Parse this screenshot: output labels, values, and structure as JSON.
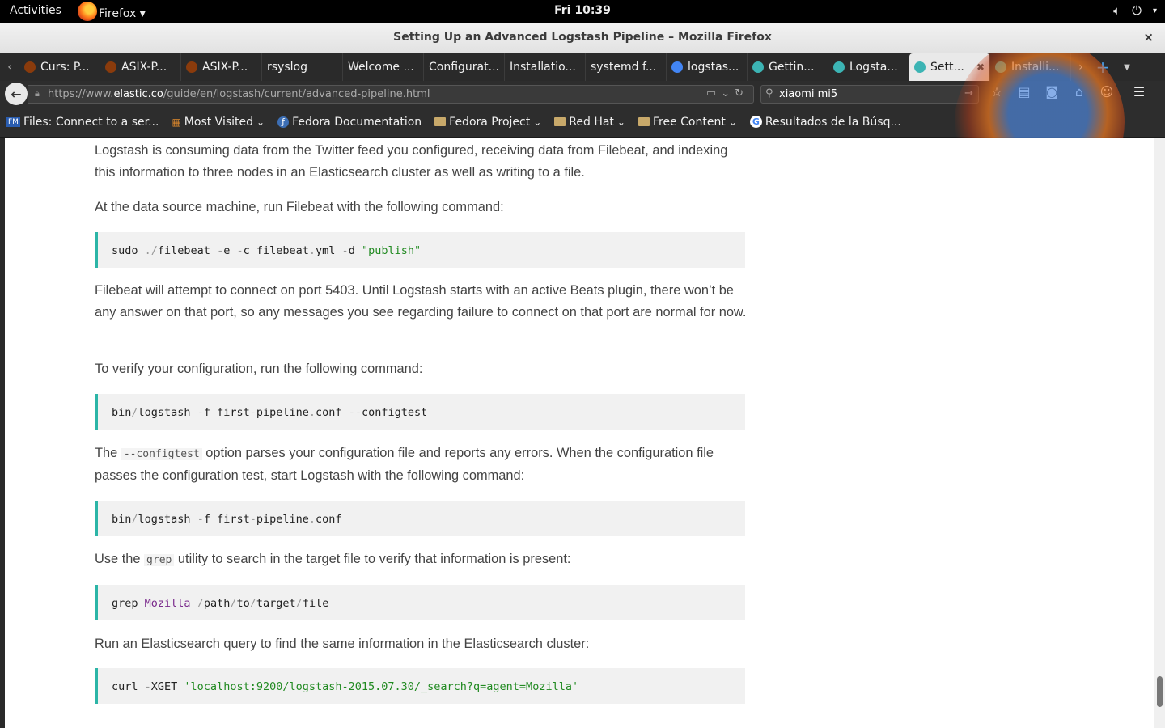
{
  "topbar": {
    "activities": "Activities",
    "app_name": "Firefox ▾",
    "clock": "Fri 10:39"
  },
  "window": {
    "title": "Setting Up an Advanced Logstash Pipeline – Mozilla Firefox",
    "close": "×"
  },
  "tabs": [
    {
      "label": "Curs: P...",
      "favicon_color": "#8a3b0c"
    },
    {
      "label": "ASIX-P...",
      "favicon_color": "#8a3b0c"
    },
    {
      "label": "ASIX-P...",
      "favicon_color": "#8a3b0c"
    },
    {
      "label": "rsyslog",
      "favicon_color": ""
    },
    {
      "label": "Welcome ...",
      "favicon_color": ""
    },
    {
      "label": "Configurat...",
      "favicon_color": ""
    },
    {
      "label": "Installatio...",
      "favicon_color": ""
    },
    {
      "label": "systemd f...",
      "favicon_color": ""
    },
    {
      "label": "logstas...",
      "favicon_color": "#4285f4"
    },
    {
      "label": "Gettin...",
      "favicon_color": "#3cb4b4"
    },
    {
      "label": "Logsta...",
      "favicon_color": "#3cb4b4"
    },
    {
      "label": "Sett...",
      "favicon_color": "#3cb4b4",
      "active": true
    },
    {
      "label": "Installi...",
      "favicon_color": "#3cb4b4"
    }
  ],
  "navbar": {
    "url_prefix": "https://www.",
    "url_domain": "elastic.co",
    "url_path": "/guide/en/logstash/current/advanced-pipeline.html",
    "search_value": "xiaomi mi5"
  },
  "bookmarks": [
    {
      "label": "Files: Connect to a ser...",
      "icon": "fm-icon"
    },
    {
      "label": "Most Visited",
      "icon": "most-visited-icon",
      "dropdown": true
    },
    {
      "label": "Fedora Documentation",
      "icon": "fedora-icon"
    },
    {
      "label": "Fedora Project",
      "icon": "folder-icon",
      "dropdown": true
    },
    {
      "label": "Red Hat",
      "icon": "folder-icon",
      "dropdown": true
    },
    {
      "label": "Free Content",
      "icon": "folder-icon",
      "dropdown": true
    },
    {
      "label": "Resultados de la Búsq...",
      "icon": "google-icon"
    }
  ],
  "article": {
    "p1": "Logstash is consuming data from the Twitter feed you configured, receiving data from Filebeat, and indexing this information to three nodes in an Elasticsearch cluster as well as writing to a file.",
    "p2": "At the data source machine, run Filebeat with the following command:",
    "code1": {
      "a": "sudo ",
      "b": "./",
      "c": "filebeat ",
      "d": "-",
      "e": "e ",
      "f": "-",
      "g": "c filebeat",
      "h": ".",
      "i": "yml ",
      "j": "-",
      "k": "d ",
      "l": "\"publish\""
    },
    "p3": "Filebeat will attempt to connect on port 5403. Until Logstash starts with an active Beats plugin, there won’t be any answer on that port, so any messages you see regarding failure to connect on that port are normal for now.",
    "p4": "To verify your configuration, run the following command:",
    "code2": {
      "a": "bin",
      "b": "/",
      "c": "logstash ",
      "d": "-",
      "e": "f first",
      "f": "-",
      "g": "pipeline",
      "h": ".",
      "i": "conf ",
      "j": "--",
      "k": "configtest"
    },
    "p5_before": "The ",
    "p5_code": "--configtest",
    "p5_after": " option parses your configuration file and reports any errors. When the configuration file passes the configuration test, start Logstash with the following command:",
    "code3": {
      "a": "bin",
      "b": "/",
      "c": "logstash ",
      "d": "-",
      "e": "f first",
      "f": "-",
      "g": "pipeline",
      "h": ".",
      "i": "conf"
    },
    "p6_before": "Use the ",
    "p6_code": "grep",
    "p6_after": " utility to search in the target file to verify that information is present:",
    "code4": {
      "a": "grep ",
      "b": "Mozilla",
      "c": " ",
      "d": "/",
      "e": "path",
      "f": "/",
      "g": "to",
      "h": "/",
      "i": "target",
      "j": "/",
      "k": "file"
    },
    "p7": "Run an Elasticsearch query to find the same information in the Elasticsearch cluster:",
    "code5": {
      "a": "curl ",
      "b": "-",
      "c": "XGET ",
      "d": "'localhost:9200/logstash-2015.07.30/_search?q=agent=Mozilla'"
    }
  },
  "colors": {
    "code_accent": "#2cb5a7",
    "code_string": "#218a21",
    "code_keyword": "#7a2a8c"
  }
}
